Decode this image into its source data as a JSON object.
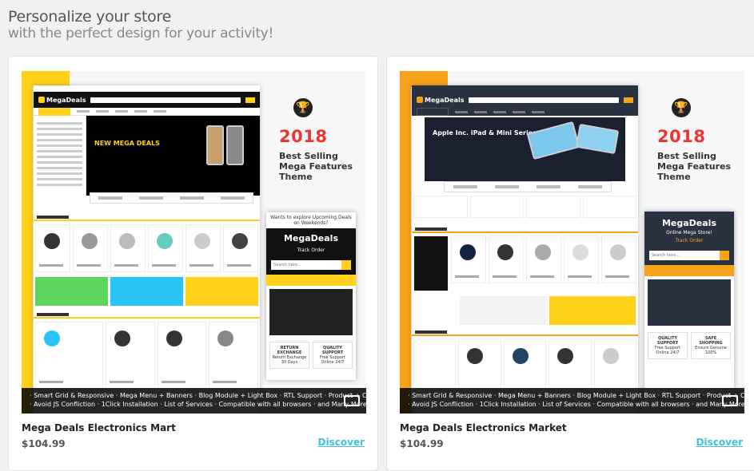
{
  "header": {
    "title": "Personalize your store",
    "subtitle": "with the perfect design for your activity!"
  },
  "features_line1": "· Smart Grid & Responsive  ·  Mega Menu + Banners  ·  Blog Module + Light Box  ·  RTL Support  ·  Product + Carousel",
  "features_line2": "· Avoid JS Confliction  ·  1Click Installation  ·  List of Services  ·  Compatible with all browsers  ·  and Many More...",
  "badge": {
    "year": "2018",
    "line1": "Best Selling",
    "line2": "Mega Features",
    "line3": "Theme",
    "trophy_icon": "trophy-icon"
  },
  "products": [
    {
      "name": "Mega Deals Electronics Mart",
      "price": "$104.99",
      "cta": "Discover",
      "accent": "#ffd11a",
      "mobile": {
        "top": "Wants to explore Upcoming Deals on Weekends?",
        "logo": "MegaDeals",
        "track": "Track Order",
        "search": "Search here...",
        "left_icon": "RETURN EXCHANGE",
        "left_sub": "Return Exchange 30 Days",
        "right_icon": "QUALITY SUPPORT",
        "right_sub": "Free Support Online 24/7"
      }
    },
    {
      "name": "Mega Deals Electronics Market",
      "price": "$104.99",
      "cta": "Discover",
      "accent": "#f7a21b",
      "mobile": {
        "logo": "MegaDeals",
        "tagline": "Online Mega Store!",
        "track": "Track Order",
        "search": "Search here...",
        "left_icon": "QUALITY SUPPORT",
        "left_sub": "Free Support Online 24/7",
        "right_icon": "SAFE SHOPPING",
        "right_sub": "Ensure Genuine 100%"
      }
    }
  ]
}
